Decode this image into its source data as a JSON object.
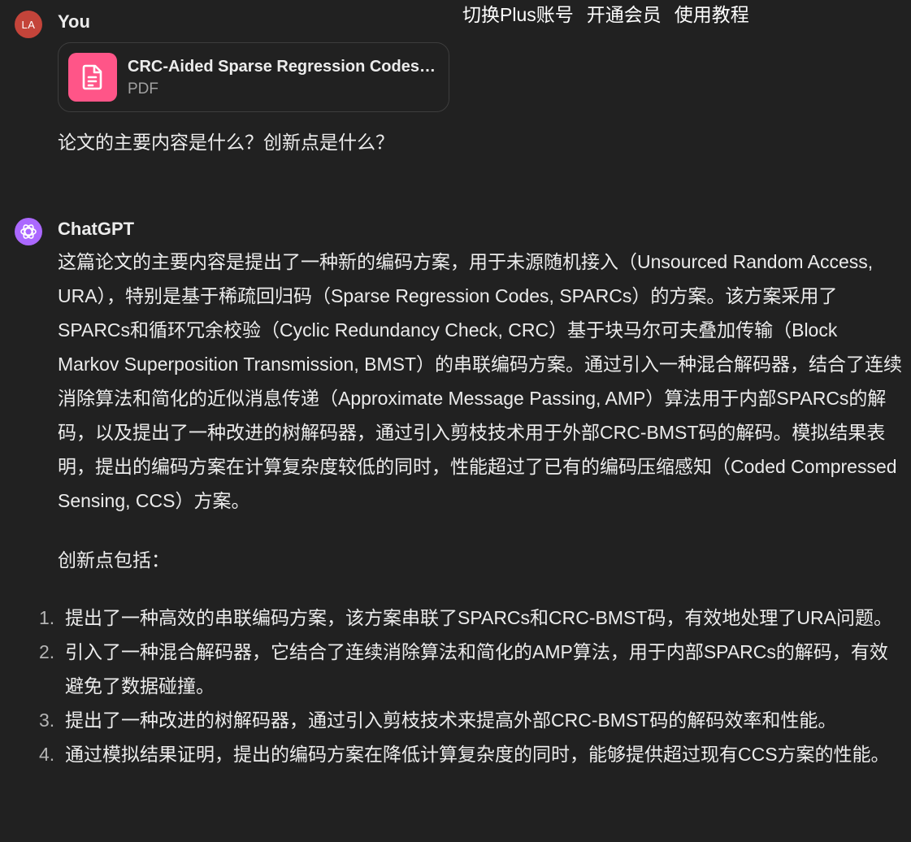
{
  "top_links": [
    "切换Plus账号",
    "开通会员",
    "使用教程"
  ],
  "user": {
    "avatar_initials": "LA",
    "name": "You",
    "attachment": {
      "file_name": "CRC-Aided Sparse Regression Codes f...",
      "file_type": "PDF",
      "icon": "document-icon"
    },
    "message": "论文的主要内容是什么？创新点是什么？"
  },
  "assistant": {
    "name": "ChatGPT",
    "icon": "openai-logo-icon",
    "paragraph": "这篇论文的主要内容是提出了一种新的编码方案，用于未源随机接入（Unsourced Random Access, URA），特别是基于稀疏回归码（Sparse Regression Codes, SPARCs）的方案。该方案采用了SPARCs和循环冗余校验（Cyclic Redundancy Check, CRC）基于块马尔可夫叠加传输（Block Markov Superposition Transmission, BMST）的串联编码方案。通过引入一种混合解码器，结合了连续消除算法和简化的近似消息传递（Approximate Message Passing, AMP）算法用于内部SPARCs的解码，以及提出了一种改进的树解码器，通过引入剪枝技术用于外部CRC-BMST码的解码。模拟结果表明，提出的编码方案在计算复杂度较低的同时，性能超过了已有的编码压缩感知（Coded Compressed Sensing, CCS）方案。",
    "innovations_heading": "创新点包括：",
    "innovations": [
      {
        "num": "1.",
        "text": "提出了一种高效的串联编码方案，该方案串联了SPARCs和CRC-BMST码，有效地处理了URA问题。"
      },
      {
        "num": "2.",
        "text": "引入了一种混合解码器，它结合了连续消除算法和简化的AMP算法，用于内部SPARCs的解码，有效避免了数据碰撞。"
      },
      {
        "num": "3.",
        "text": "提出了一种改进的树解码器，通过引入剪枝技术来提高外部CRC-BMST码的解码效率和性能。"
      },
      {
        "num": "4.",
        "text": "通过模拟结果证明，提出的编码方案在降低计算复杂度的同时，能够提供超过现有CCS方案的性能。"
      }
    ]
  },
  "colors": {
    "background": "#212121",
    "text": "#ececec",
    "user_avatar": "#c4443a",
    "bot_avatar": "#ab68ff",
    "file_icon": "#ff5588"
  }
}
